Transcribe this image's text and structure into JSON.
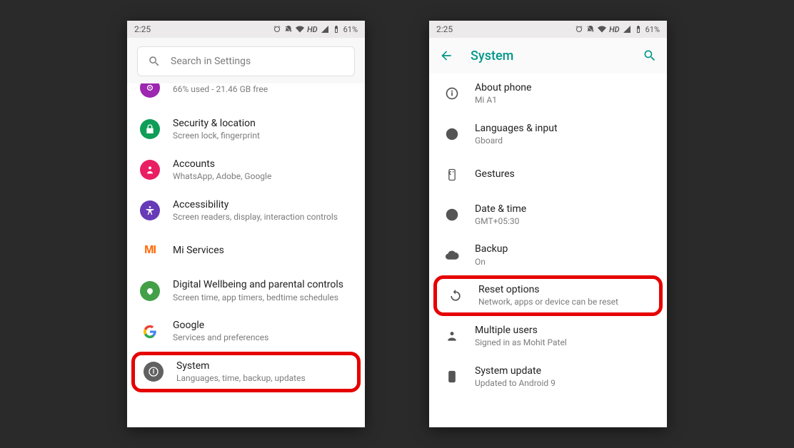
{
  "status": {
    "time": "2:25",
    "battery": "61%",
    "hd": "HD"
  },
  "search": {
    "placeholder": "Search in Settings"
  },
  "settings": {
    "storage_sub": "66% used - 21.46 GB free",
    "security": {
      "title": "Security & location",
      "sub": "Screen lock, fingerprint"
    },
    "accounts": {
      "title": "Accounts",
      "sub": "WhatsApp, Adobe, Google"
    },
    "accessibility": {
      "title": "Accessibility",
      "sub": "Screen readers, display, interaction controls"
    },
    "mi": {
      "title": "Mi Services"
    },
    "wellbeing": {
      "title": "Digital Wellbeing and parental controls",
      "sub": "Screen time, app timers, bedtime schedules"
    },
    "google": {
      "title": "Google",
      "sub": "Services and preferences"
    },
    "system": {
      "title": "System",
      "sub": "Languages, time, backup, updates"
    }
  },
  "system_page": {
    "title": "System",
    "about": {
      "title": "About phone",
      "sub": "Mi A1"
    },
    "lang": {
      "title": "Languages & input",
      "sub": "Gboard"
    },
    "gestures": {
      "title": "Gestures"
    },
    "datetime": {
      "title": "Date & time",
      "sub": "GMT+05:30"
    },
    "backup": {
      "title": "Backup",
      "sub": "On"
    },
    "reset": {
      "title": "Reset options",
      "sub": "Network, apps or device can be reset"
    },
    "users": {
      "title": "Multiple users",
      "sub": "Signed in as Mohit Patel"
    },
    "update": {
      "title": "System update",
      "sub": "Updated to Android 9"
    }
  }
}
